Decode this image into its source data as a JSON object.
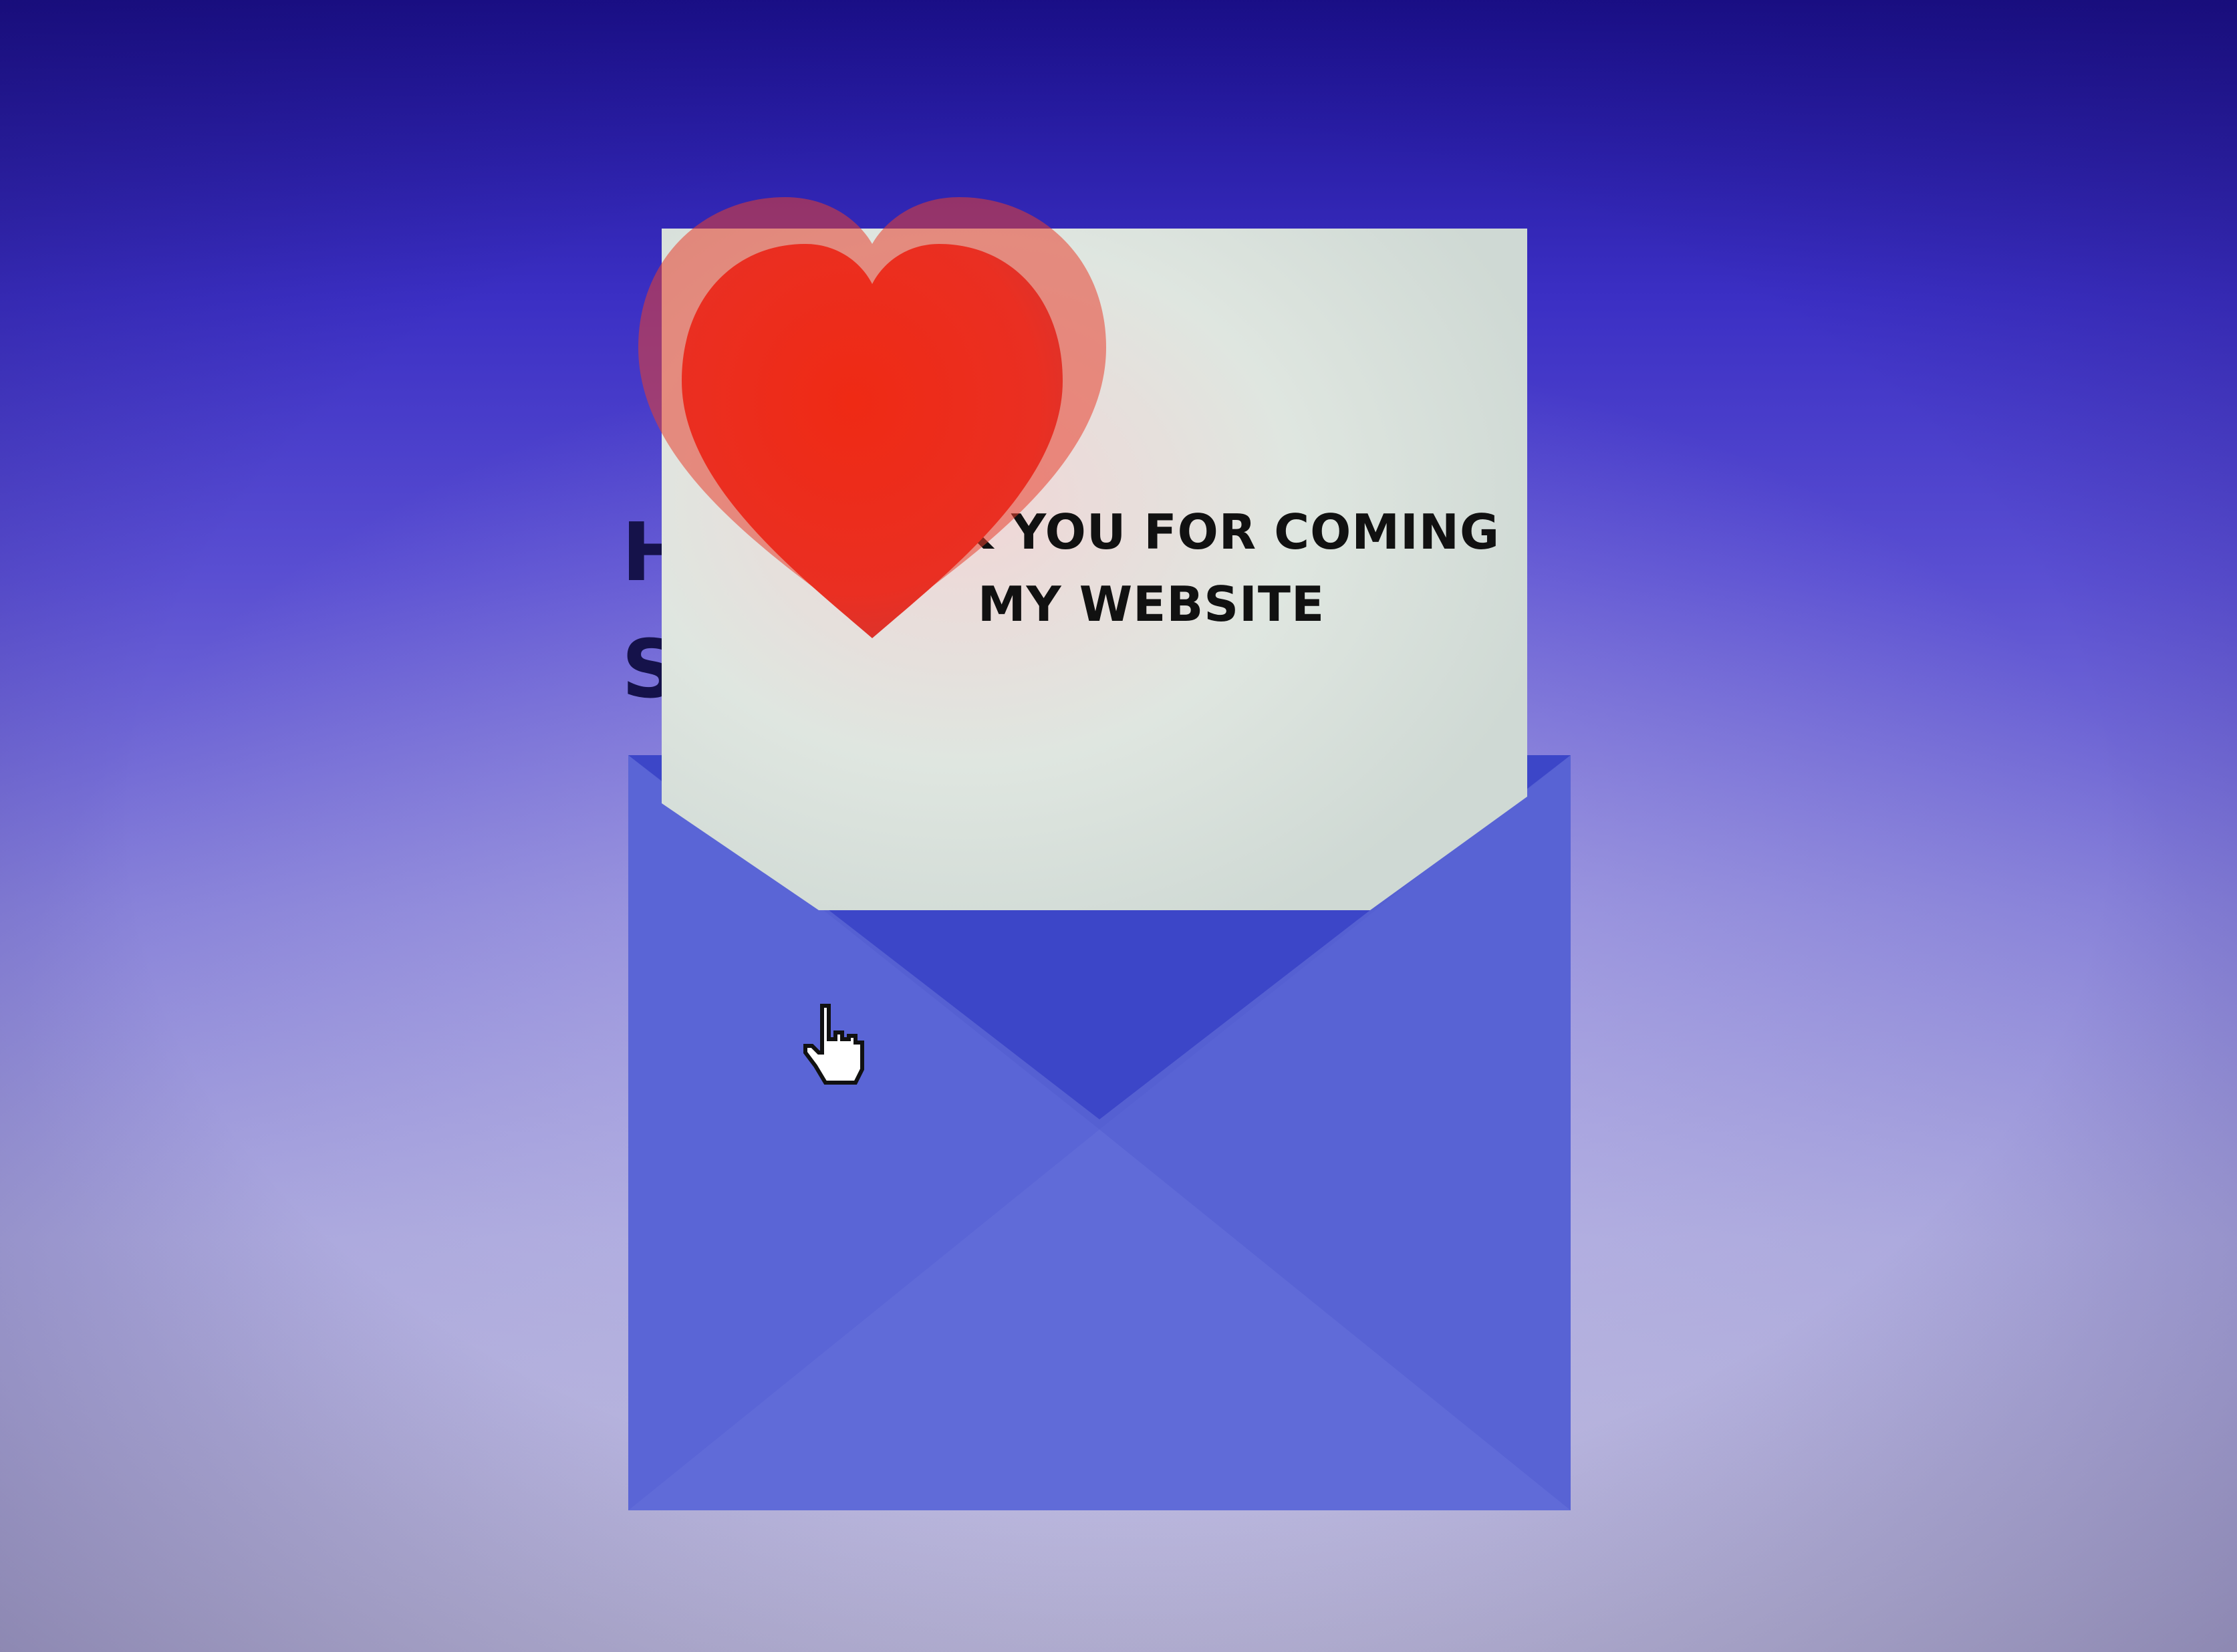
{
  "letter": {
    "message": "THANK YOU FOR COMING MY WEBSITE"
  },
  "colors": {
    "envelope_body": "#5560d2",
    "envelope_flap": "#3c46c8",
    "envelope_fold": "#4a55cc",
    "letter_paper": "#dde5df",
    "heart": "#ee2c1c",
    "text": "#111111"
  },
  "icons": {
    "heart": "heart-icon",
    "pointer": "hand-pointer-icon"
  }
}
